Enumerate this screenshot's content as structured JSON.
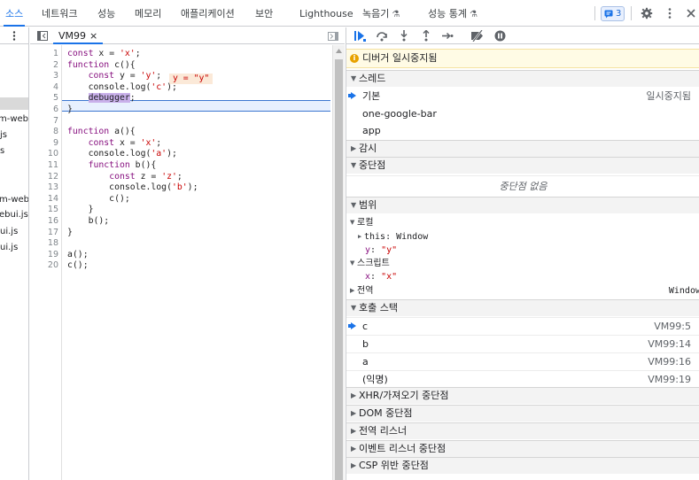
{
  "tabs": {
    "sources": "소스",
    "network": "네트워크",
    "performance": "성능",
    "memory": "메모리",
    "application": "애플리케이션",
    "security": "보안",
    "lighthouse": "Lighthouse",
    "recorder": "녹음기",
    "perf_insights": "성능 통계"
  },
  "issues_count": "3",
  "navigator": {
    "files": [
      "m-webui",
      "js",
      "s",
      "m-web",
      "ebui.js",
      "ui.js",
      "ui.js"
    ]
  },
  "editor": {
    "file_tab": "VM99",
    "close_glyph": "×",
    "inline_value": "y = \"y\"",
    "line_numbers": [
      "1",
      "2",
      "3",
      "4",
      "5",
      "6",
      "7",
      "8",
      "9",
      "10",
      "11",
      "12",
      "13",
      "14",
      "15",
      "16",
      "17",
      "18",
      "19",
      "20"
    ]
  },
  "sidebar": {
    "paused_text": "디버거 일시중지됨",
    "threads_title": "스레드",
    "threads": [
      {
        "name": "기본",
        "status": "일시중지됨"
      },
      {
        "name": "one-google-bar",
        "status": ""
      },
      {
        "name": "app",
        "status": ""
      }
    ],
    "watch_title": "감시",
    "breakpoints_title": "중단점",
    "breakpoints_empty": "중단점 없음",
    "scope_title": "범위",
    "scope": {
      "local_title": "로컬",
      "this_label": "this: Window",
      "y_name": "y",
      "y_value": "\"y\"",
      "script_title": "스크립트",
      "x_name": "x",
      "x_value": "\"x\"",
      "global_title": "전역",
      "global_value": "Window"
    },
    "callstack_title": "호출 스택",
    "callstack": [
      {
        "name": "c",
        "location": "VM99:5"
      },
      {
        "name": "b",
        "location": "VM99:14"
      },
      {
        "name": "a",
        "location": "VM99:16"
      },
      {
        "name": "(익명)",
        "location": "VM99:19"
      }
    ],
    "xhr_title": "XHR/가져오기 중단점",
    "dom_title": "DOM 중단점",
    "global_listeners_title": "전역 리스너",
    "event_listener_title": "이벤트 리스너 중단점",
    "csp_title": "CSP 위반 중단점"
  }
}
